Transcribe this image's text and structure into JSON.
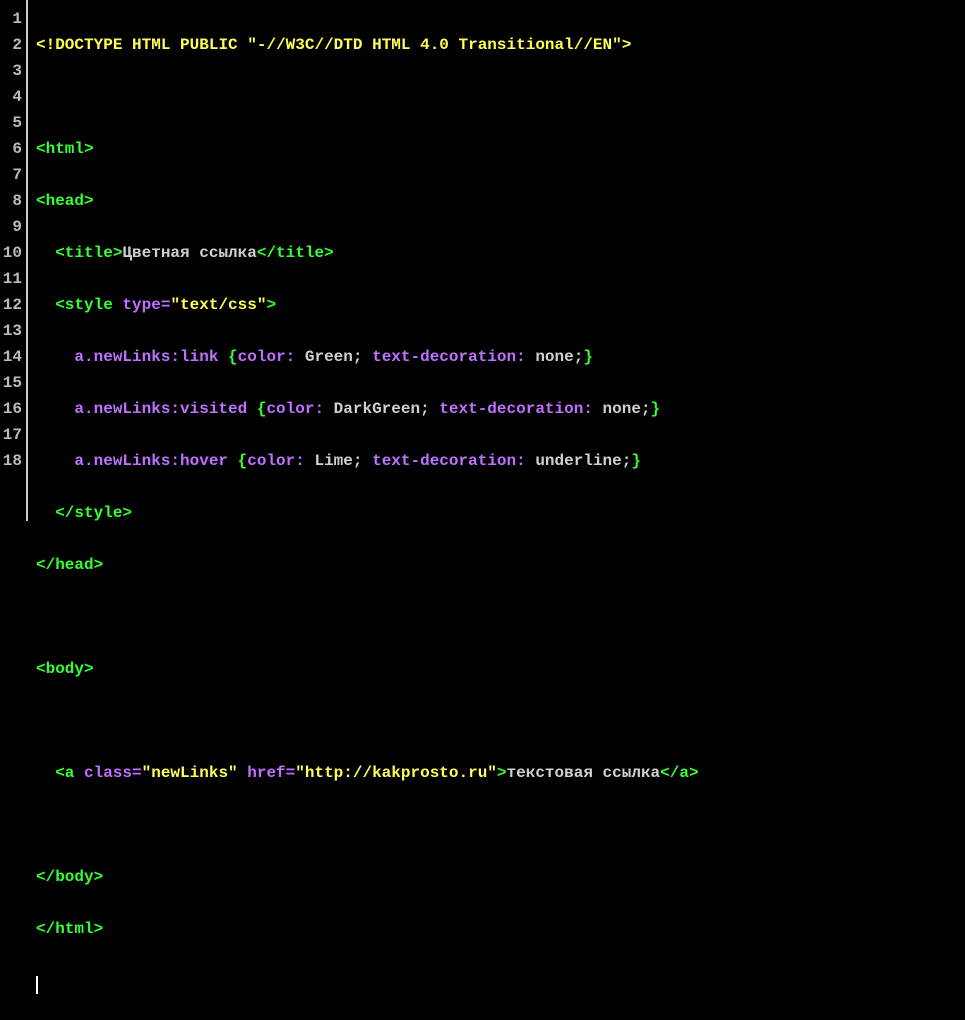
{
  "gutter": [
    "1",
    "2",
    "3",
    "4",
    "5",
    "6",
    "7",
    "8",
    "9",
    "10",
    "11",
    "12",
    "13",
    "14",
    "15",
    "16",
    "17",
    "18"
  ],
  "code": {
    "l1": {
      "doctype_open": "<!DOCTYPE",
      "doctype_kw": "HTML",
      "doctype_kw2": "PUBLIC",
      "doctype_str": "\"-//W3C//DTD HTML 4.0 Transitional//EN\"",
      "doctype_close": ">"
    },
    "l3": {
      "open": "<html>"
    },
    "l4": {
      "open": "<head>"
    },
    "l5": {
      "open": "<title>",
      "text": "Цветная ссылка",
      "close": "</title>"
    },
    "l6": {
      "open": "<style",
      "attr": "type=",
      "str": "\"text/css\"",
      "close": ">"
    },
    "l7": {
      "sel": "a.newLinks:link",
      "lb": "{",
      "p1": "color:",
      "v1": "Green;",
      "p2": "text-decoration:",
      "v2": "none;",
      "rb": "}"
    },
    "l8": {
      "sel": "a.newLinks:visited",
      "lb": "{",
      "p1": "color:",
      "v1": "DarkGreen;",
      "p2": "text-decoration:",
      "v2": "none;",
      "rb": "}"
    },
    "l9": {
      "sel": "a.newLinks:hover",
      "lb": "{",
      "p1": "color:",
      "v1": "Lime;",
      "p2": "text-decoration:",
      "v2": "underline;",
      "rb": "}"
    },
    "l10": {
      "close": "</style>"
    },
    "l11": {
      "close": "</head>"
    },
    "l13": {
      "open": "<body>"
    },
    "l15": {
      "open": "<a",
      "attr1": "class=",
      "str1": "\"newLinks\"",
      "attr2": "href=",
      "str2": "\"http://kakprosto.ru\"",
      "gt": ">",
      "text": "текстовая ссылка",
      "close": "</a>"
    },
    "l17": {
      "close": "</body>"
    },
    "l18": {
      "close": "</html>"
    }
  }
}
